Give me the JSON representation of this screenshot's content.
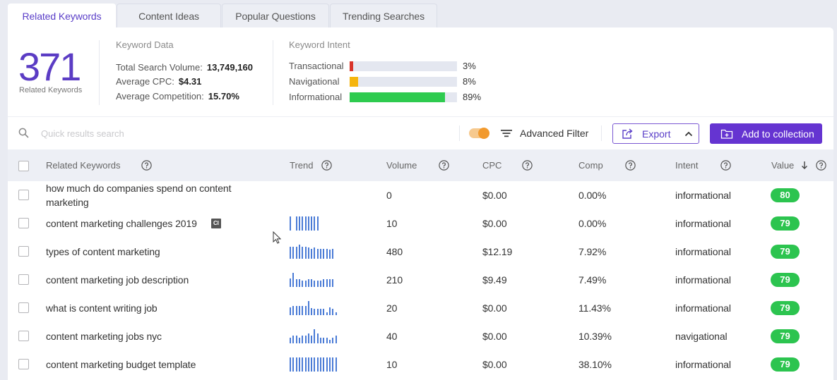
{
  "tabs": [
    {
      "label": "Related Keywords",
      "active": true
    },
    {
      "label": "Content Ideas",
      "active": false
    },
    {
      "label": "Popular Questions",
      "active": false
    },
    {
      "label": "Trending Searches",
      "active": false
    }
  ],
  "summary": {
    "count": "371",
    "count_label": "Related Keywords",
    "keyword_data": {
      "title": "Keyword Data",
      "rows": [
        {
          "label": "Total Search Volume:",
          "value": "13,749,160"
        },
        {
          "label": "Average CPC:",
          "value": "$4.31"
        },
        {
          "label": "Average Competition:",
          "value": "15.70%"
        }
      ]
    },
    "keyword_intent": {
      "title": "Keyword Intent",
      "rows": [
        {
          "label": "Transactional",
          "percent": 3,
          "display": "3%",
          "color": "#d8342a"
        },
        {
          "label": "Navigational",
          "percent": 8,
          "display": "8%",
          "color": "#f5b50e"
        },
        {
          "label": "Informational",
          "percent": 89,
          "display": "89%",
          "color": "#2ecb4f"
        }
      ]
    }
  },
  "toolbar": {
    "search_placeholder": "Quick results search",
    "search_value": "",
    "toggle_on": true,
    "advanced_filter_label": "Advanced Filter",
    "export_label": "Export",
    "add_to_collection_label": "Add to collection"
  },
  "table": {
    "columns": [
      {
        "label": "Related Keywords"
      },
      {
        "label": "Trend"
      },
      {
        "label": "Volume"
      },
      {
        "label": "CPC"
      },
      {
        "label": "Comp"
      },
      {
        "label": "Intent"
      },
      {
        "label": "Value",
        "sort": "desc"
      }
    ],
    "rows": [
      {
        "keyword": "how much do companies spend on content marketing",
        "badge": "",
        "trend": [],
        "volume": "0",
        "cpc": "$0.00",
        "comp": "0.00%",
        "intent": "informational",
        "value": "80"
      },
      {
        "keyword": "content marketing challenges 2019",
        "badge": "CI",
        "trend": [
          1,
          0,
          1,
          1,
          1,
          1,
          1,
          1,
          1,
          1
        ],
        "volume": "10",
        "cpc": "$0.00",
        "comp": "0.00%",
        "intent": "informational",
        "value": "79"
      },
      {
        "keyword": "types of content marketing",
        "badge": "",
        "trend": [
          0.83,
          0.83,
          0.83,
          1,
          0.87,
          0.87,
          0.8,
          0.72,
          0.8,
          0.72,
          0.72,
          0.72,
          0.72,
          0.63,
          0.72
        ],
        "volume": "480",
        "cpc": "$12.19",
        "comp": "7.92%",
        "intent": "informational",
        "value": "79"
      },
      {
        "keyword": "content marketing job description",
        "badge": "",
        "trend": [
          0.58,
          1,
          0.55,
          0.55,
          0.47,
          0.47,
          0.55,
          0.55,
          0.47,
          0.47,
          0.47,
          0.55,
          0.55,
          0.55,
          0.55
        ],
        "volume": "210",
        "cpc": "$9.49",
        "comp": "7.49%",
        "intent": "informational",
        "value": "79"
      },
      {
        "keyword": "what is content writing job",
        "badge": "",
        "trend": [
          0.55,
          0.65,
          0.65,
          0.65,
          0.65,
          0.65,
          1,
          0.5,
          0.45,
          0.45,
          0.45,
          0.45,
          0.2,
          0.55,
          0.45,
          0.2
        ],
        "volume": "20",
        "cpc": "$0.00",
        "comp": "11.43%",
        "intent": "informational",
        "value": "79"
      },
      {
        "keyword": "content marketing jobs nyc",
        "badge": "",
        "trend": [
          0.39,
          0.57,
          0.57,
          0.39,
          0.57,
          0.57,
          0.7,
          0.57,
          1,
          0.7,
          0.39,
          0.39,
          0.39,
          0.23,
          0.39,
          0.57
        ],
        "volume": "40",
        "cpc": "$0.00",
        "comp": "10.39%",
        "intent": "navigational",
        "value": "79"
      },
      {
        "keyword": "content marketing budget template",
        "badge": "",
        "trend": [
          1,
          1,
          1,
          1,
          1,
          1,
          1,
          1,
          1,
          1,
          1,
          1,
          1,
          1,
          1,
          1
        ],
        "volume": "10",
        "cpc": "$0.00",
        "comp": "38.10%",
        "intent": "informational",
        "value": "79"
      }
    ]
  },
  "colors": {
    "accent": "#6534d1",
    "accent_text": "#5a3ec8",
    "value_badge": "#2cc44f",
    "trend_bar": "#4a7bd6",
    "toggle_knob": "#f29a2e"
  }
}
